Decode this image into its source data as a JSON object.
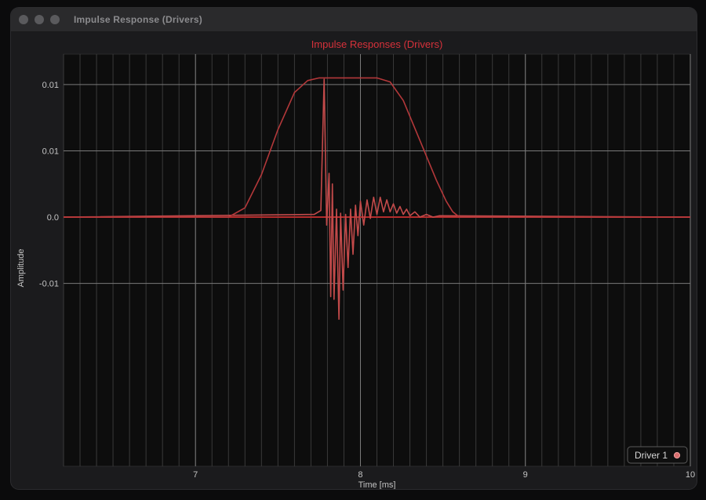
{
  "window": {
    "title": "Impulse Response (Drivers)"
  },
  "colors": {
    "title": "#d6313a",
    "series": "#c34a4a",
    "envelope": "#b3383a",
    "zero": "#b32c2c",
    "grid_major": "#7a7a7a",
    "grid_minor": "#3a3a3a",
    "tick_text": "#c4c4c4",
    "plot_bg": "#0d0d0d"
  },
  "chart_data": {
    "type": "line",
    "title": "Impulse Responses (Drivers)",
    "xlabel": "Time [ms]",
    "ylabel": "Amplitude",
    "xlim": [
      6.2,
      10.0
    ],
    "ylim": [
      -0.0188,
      0.0123
    ],
    "x_ticks": [
      {
        "value": 7,
        "label": "7"
      },
      {
        "value": 8,
        "label": "8"
      },
      {
        "value": 9,
        "label": "9"
      },
      {
        "value": 10,
        "label": "10"
      }
    ],
    "y_ticks": [
      {
        "value": 0.01,
        "label": "0.01"
      },
      {
        "value": 0.005,
        "label": "0.01"
      },
      {
        "value": 0.0,
        "label": "0.0"
      },
      {
        "value": -0.005,
        "label": "-0.01"
      }
    ],
    "grid": true,
    "legend_position": "bottom-right",
    "series": [
      {
        "name": "Driver 1",
        "x": [
          6.2,
          7.72,
          7.76,
          7.78,
          7.795,
          7.81,
          7.82,
          7.83,
          7.84,
          7.855,
          7.87,
          7.88,
          7.895,
          7.91,
          7.925,
          7.94,
          7.955,
          7.97,
          7.985,
          8.0,
          8.02,
          8.04,
          8.06,
          8.08,
          8.1,
          8.12,
          8.14,
          8.16,
          8.18,
          8.2,
          8.22,
          8.24,
          8.26,
          8.28,
          8.3,
          8.33,
          8.36,
          8.4,
          8.44,
          8.48,
          10.0
        ],
        "y": [
          0.0,
          0.0002,
          0.0005,
          0.0104,
          -0.0006,
          0.0033,
          -0.006,
          0.0025,
          -0.0062,
          0.0006,
          -0.0077,
          0.0003,
          -0.0055,
          0.0002,
          -0.0038,
          0.0006,
          -0.0028,
          0.0009,
          -0.0014,
          0.0012,
          -0.0006,
          0.0013,
          -0.0001,
          0.0015,
          0.0002,
          0.0015,
          0.0004,
          0.0013,
          0.0004,
          0.001,
          0.0003,
          0.0008,
          0.0002,
          0.0006,
          0.0001,
          0.0004,
          0.0,
          0.0002,
          0.0,
          0.0001,
          0.0
        ]
      },
      {
        "x": [
          6.2,
          7.2,
          7.3,
          7.4,
          7.5,
          7.6,
          7.68,
          7.75,
          8.1,
          8.18,
          8.26,
          8.36,
          8.46,
          8.52,
          8.56,
          8.6,
          10.0
        ],
        "y": [
          0.0,
          0.0,
          0.0007,
          0.0032,
          0.0066,
          0.0094,
          0.0103,
          0.0105,
          0.0105,
          0.0102,
          0.0088,
          0.0058,
          0.0028,
          0.0012,
          0.0004,
          0.0,
          0.0
        ]
      }
    ]
  }
}
